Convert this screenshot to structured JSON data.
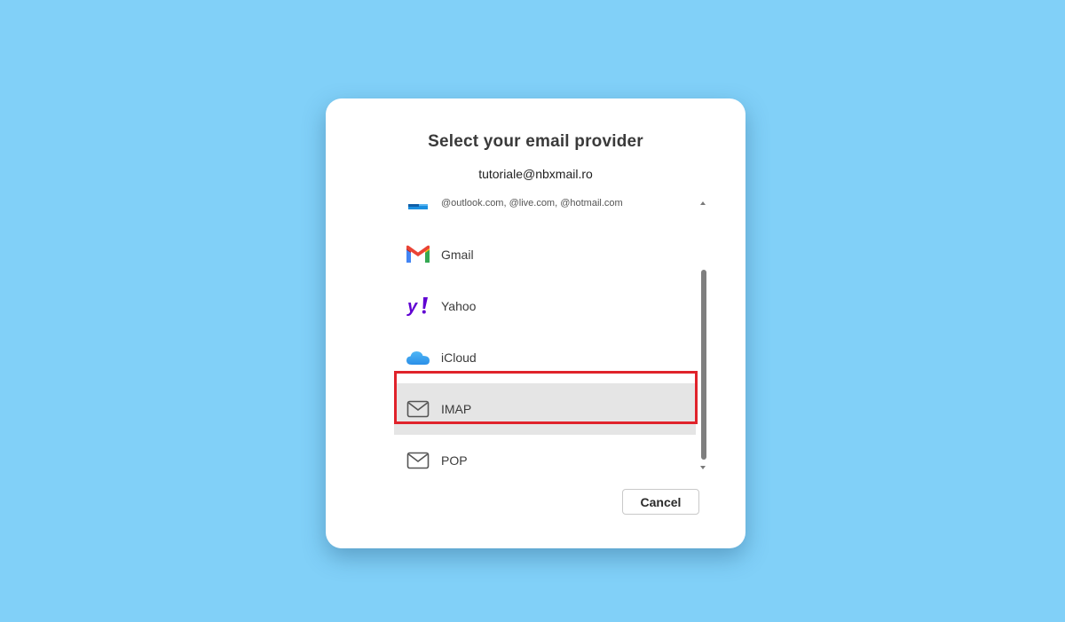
{
  "dialog": {
    "title": "Select your email provider",
    "account": "tutoriale@nbxmail.ro"
  },
  "providers": [
    {
      "label": "@outlook.com, @live.com, @hotmail.com",
      "icon": "outlook-icon",
      "partially_visible": true
    },
    {
      "label": "Gmail",
      "icon": "gmail-icon"
    },
    {
      "label": "Yahoo",
      "icon": "yahoo-icon"
    },
    {
      "label": "iCloud",
      "icon": "icloud-icon"
    },
    {
      "label": "IMAP",
      "icon": "envelope-icon",
      "selected": true
    },
    {
      "label": "POP",
      "icon": "envelope-icon"
    }
  ],
  "buttons": {
    "cancel": "Cancel"
  },
  "colors": {
    "background": "#81d0f8",
    "selected_row": "#e5e5e5",
    "highlight_border": "#e0232b",
    "yahoo_purple": "#6001d2",
    "outlook_blue": "#0f78d4"
  },
  "scroll": {
    "position_fraction": 0.28
  }
}
